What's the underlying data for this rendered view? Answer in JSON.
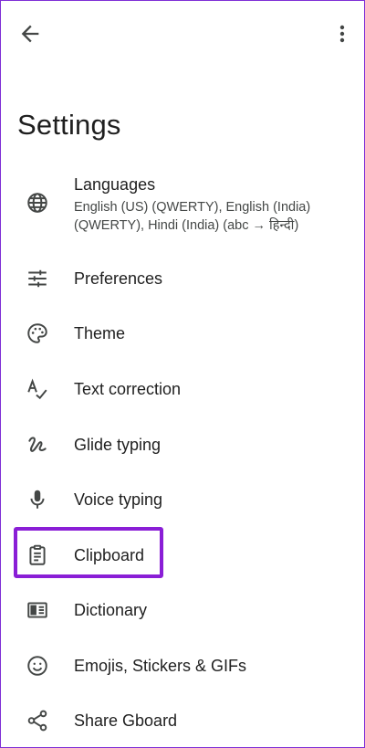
{
  "title": "Settings",
  "topbar": {
    "back_icon": "arrow-back-icon",
    "more_icon": "more-vert-icon"
  },
  "items": [
    {
      "label": "Languages",
      "subtitle": "English (US) (QWERTY), English (India) (QWERTY), Hindi (India) (abc → हिन्दी)",
      "icon": "globe-icon"
    },
    {
      "label": "Preferences",
      "icon": "tune-icon"
    },
    {
      "label": "Theme",
      "icon": "palette-icon"
    },
    {
      "label": "Text correction",
      "icon": "spellcheck-icon"
    },
    {
      "label": "Glide typing",
      "icon": "gesture-icon"
    },
    {
      "label": "Voice typing",
      "icon": "mic-icon"
    },
    {
      "label": "Clipboard",
      "icon": "clipboard-icon"
    },
    {
      "label": "Dictionary",
      "icon": "dictionary-icon"
    },
    {
      "label": "Emojis, Stickers & GIFs",
      "icon": "emoji-icon"
    },
    {
      "label": "Share Gboard",
      "icon": "share-icon"
    }
  ],
  "colors": {
    "highlight": "#8a1ed6",
    "text": "#1f1f1f",
    "subtext": "#444746",
    "border": "#7f2fd6"
  }
}
